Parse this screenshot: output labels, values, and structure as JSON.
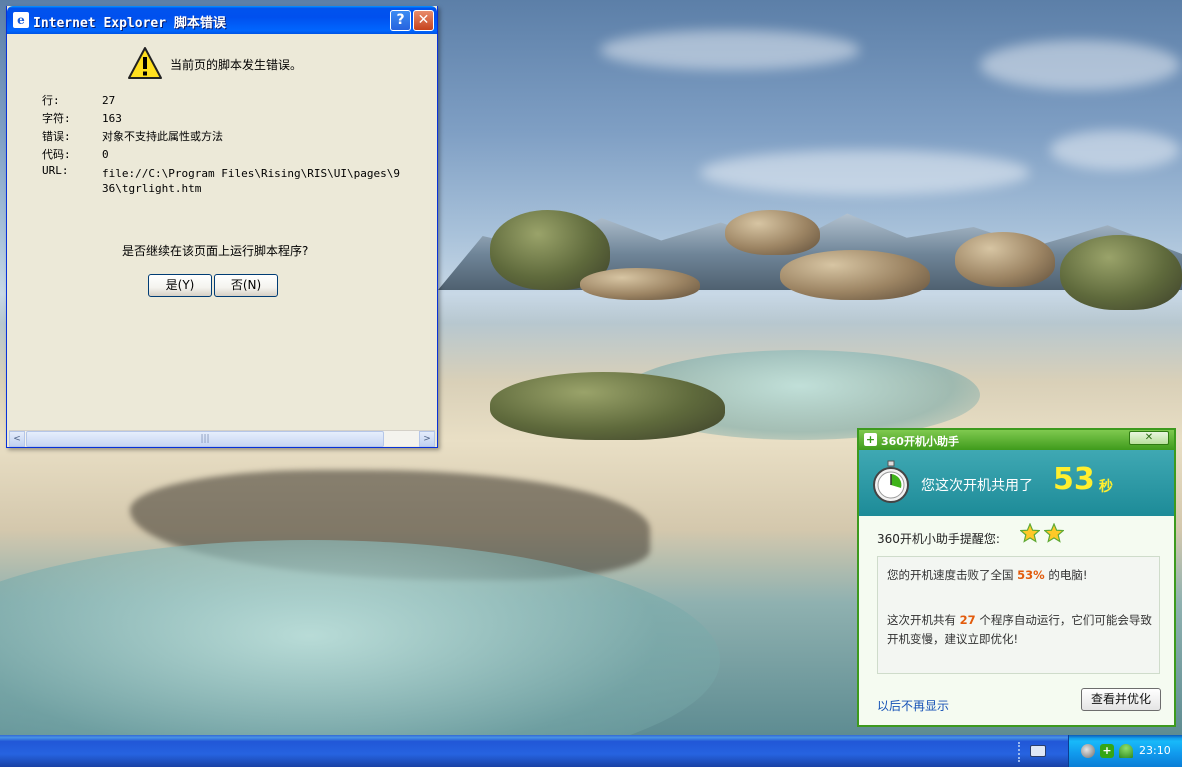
{
  "ie_dialog": {
    "title": "Internet Explorer 脚本错误",
    "help_glyph": "?",
    "close_glyph": "✕",
    "headline": "当前页的脚本发生错误。",
    "rows": [
      {
        "label": "行:",
        "value": "27"
      },
      {
        "label": "字符:",
        "value": "163"
      },
      {
        "label": "错误:",
        "value": "对象不支持此属性或方法"
      },
      {
        "label": "代码:",
        "value": "0"
      },
      {
        "label": "URL:",
        "value": ""
      }
    ],
    "url_value": "file://C:\\Program Files\\Rising\\RIS\\UI\\pages\\936\\tgrlight.htm",
    "question": "是否继续在该页面上运行脚本程序?",
    "yes_label": "是(Y)",
    "no_label": "否(N)",
    "scroll_left": "<",
    "scroll_right": ">",
    "scroll_grip": "|||"
  },
  "popup360": {
    "title": "360开机小助手",
    "close_glyph": "✕",
    "banner_text": "您这次开机共用了",
    "seconds": "53",
    "seconds_unit": "秒",
    "remind_label": "360开机小助手提醒您:",
    "rating_stars": 2,
    "line1_pre": "您的开机速度击败了全国 ",
    "line1_pct": "53%",
    "line1_post": " 的电脑!",
    "line2_pre": "这次开机共有 ",
    "line2_count": "27",
    "line2_post": " 个程序自动运行，它们可能会导致开机变慢，建议立即优化!",
    "dont_show": "以后不再显示",
    "optimize_button": "查看并优化"
  },
  "taskbar": {
    "clock": "23:10"
  },
  "colors": {
    "xp_blue": "#0053ee",
    "green_360": "#3f9b1c",
    "highlight_orange": "#e25b0c",
    "seconds_yellow": "#ffef2e"
  }
}
